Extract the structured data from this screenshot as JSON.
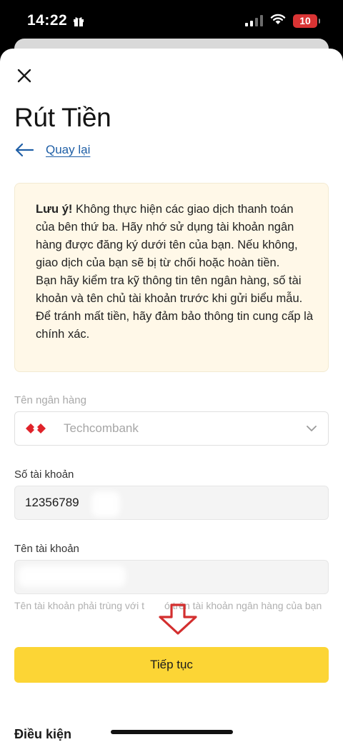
{
  "status_bar": {
    "time": "14:22",
    "battery": "10"
  },
  "header": {
    "title": "Rút Tiền",
    "back_label": "Quay lại"
  },
  "notice": {
    "bold": "Lưu ý!",
    "line1": " Không thực hiện các giao dịch thanh toán của bên thứ ba. Hãy nhớ sử dụng tài khoản ngân hàng được đăng ký dưới tên của bạn. Nếu không, giao dịch của bạn sẽ bị từ chối hoặc hoàn tiền.",
    "line2": "Bạn hãy kiểm tra kỹ thông tin tên ngân hàng, số tài khoản và tên chủ tài khoản trước khi gửi biểu mẫu. Để tránh mất tiền, hãy đảm bảo thông tin cung cấp là chính xác."
  },
  "form": {
    "bank_label": "Tên ngân hàng",
    "bank_value": "Techcombank",
    "account_number_label": "Số tài khoản",
    "account_number_value": "12356789",
    "account_name_label": "Tên tài khoản",
    "account_name_value": "",
    "hint_part1": "Tên tài khoản phải trùng với t",
    "hint_part2": "ó trên tài khoản ngân hàng của bạn",
    "submit_label": "Tiếp tục"
  },
  "footer": {
    "terms_title": "Điều kiện"
  },
  "colors": {
    "accent_yellow": "#fcd535",
    "link_blue": "#1f5fa6",
    "notice_bg": "#fff8e8",
    "arrow_red": "#d32f2f",
    "bank_logo_red": "#e0232a"
  },
  "icons": [
    "gift-icon",
    "cellular-signal-icon",
    "wifi-icon",
    "battery-icon",
    "close-icon",
    "arrow-left-icon",
    "techcombank-logo",
    "chevron-down-icon",
    "red-down-arrow-icon"
  ]
}
